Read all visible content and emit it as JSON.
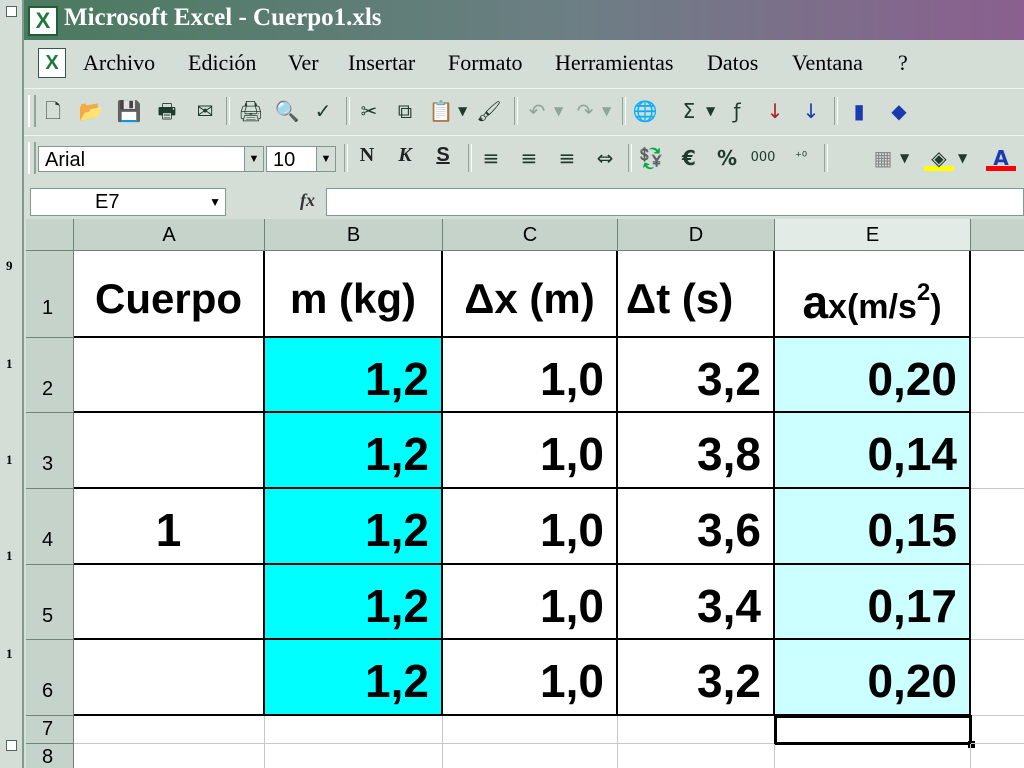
{
  "titlebar": {
    "title": "Microsoft Excel - Cuerpo1.xls"
  },
  "menu": [
    "Archivo",
    "Edición",
    "Ver",
    "Insertar",
    "Formato",
    "Herramientas",
    "Datos",
    "Ventana",
    "?"
  ],
  "format_toolbar": {
    "font_name": "Arial",
    "font_size": "10",
    "bold": "N",
    "italic": "K",
    "underline": "S",
    "euro": "€",
    "percent": "%",
    "thousands": "000"
  },
  "standard_toolbar": {
    "sum": "Σ"
  },
  "formula_bar": {
    "name_box": "E7",
    "fx_label": "fx",
    "formula": ""
  },
  "sheet": {
    "columns": [
      "A",
      "B",
      "C",
      "D",
      "E"
    ],
    "rows": [
      "1",
      "2",
      "3",
      "4",
      "5",
      "6",
      "7",
      "8"
    ],
    "header": {
      "a": "Cuerpo",
      "b": "m (kg)",
      "c": "Δx (m)",
      "d": "Δt (s)",
      "e_main": "a",
      "e_sub": "x(m/s",
      "e_sup": "2",
      "e_close": ")"
    },
    "body_label": "1",
    "data": [
      {
        "m": "1,2",
        "dx": "1,0",
        "dt": "3,2",
        "ax": "0,20"
      },
      {
        "m": "1,2",
        "dx": "1,0",
        "dt": "3,8",
        "ax": "0,14"
      },
      {
        "m": "1,2",
        "dx": "1,0",
        "dt": "3,6",
        "ax": "0,15"
      },
      {
        "m": "1,2",
        "dx": "1,0",
        "dt": "3,4",
        "ax": "0,17"
      },
      {
        "m": "1,2",
        "dx": "1,0",
        "dt": "3,2",
        "ax": "0,20"
      }
    ],
    "colors": {
      "mass_fill": "#00ffff",
      "accel_fill": "#ccffff"
    }
  },
  "left_strip": [
    "9",
    "1",
    "1",
    "1",
    "1"
  ]
}
